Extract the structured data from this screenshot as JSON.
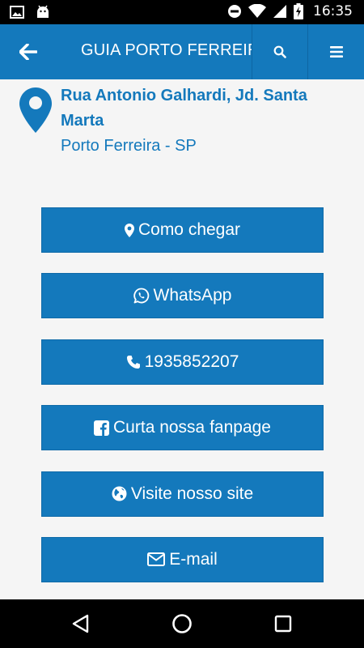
{
  "status_bar": {
    "time": "16:35",
    "icons": [
      "image-icon",
      "android-icon",
      "do-not-disturb-icon",
      "wifi-icon",
      "signal-icon",
      "battery-charging-icon"
    ]
  },
  "app_bar": {
    "title": "GUIA PORTO FERREIRA",
    "back_icon": "arrow-left-icon",
    "search_icon": "search-icon",
    "menu_icon": "menu-icon"
  },
  "address": {
    "icon": "map-marker-icon",
    "street": "Rua Antonio Galhardi, Jd. Santa Marta",
    "city": "Porto Ferreira - SP"
  },
  "actions": [
    {
      "label": "Como chegar",
      "icon": "map-marker-icon"
    },
    {
      "label": "WhatsApp",
      "icon": "whatsapp-icon"
    },
    {
      "label": "1935852207",
      "icon": "phone-icon"
    },
    {
      "label": "Curta nossa fanpage",
      "icon": "facebook-icon"
    },
    {
      "label": "Visite nosso site",
      "icon": "globe-icon"
    },
    {
      "label": "E-mail",
      "icon": "envelope-icon"
    }
  ],
  "nav_bar": {
    "icons": [
      "nav-back-icon",
      "nav-home-icon",
      "nav-recents-icon"
    ]
  },
  "colors": {
    "primary": "#1479bc",
    "background": "#f5f5f5",
    "system_bars": "#000000"
  }
}
